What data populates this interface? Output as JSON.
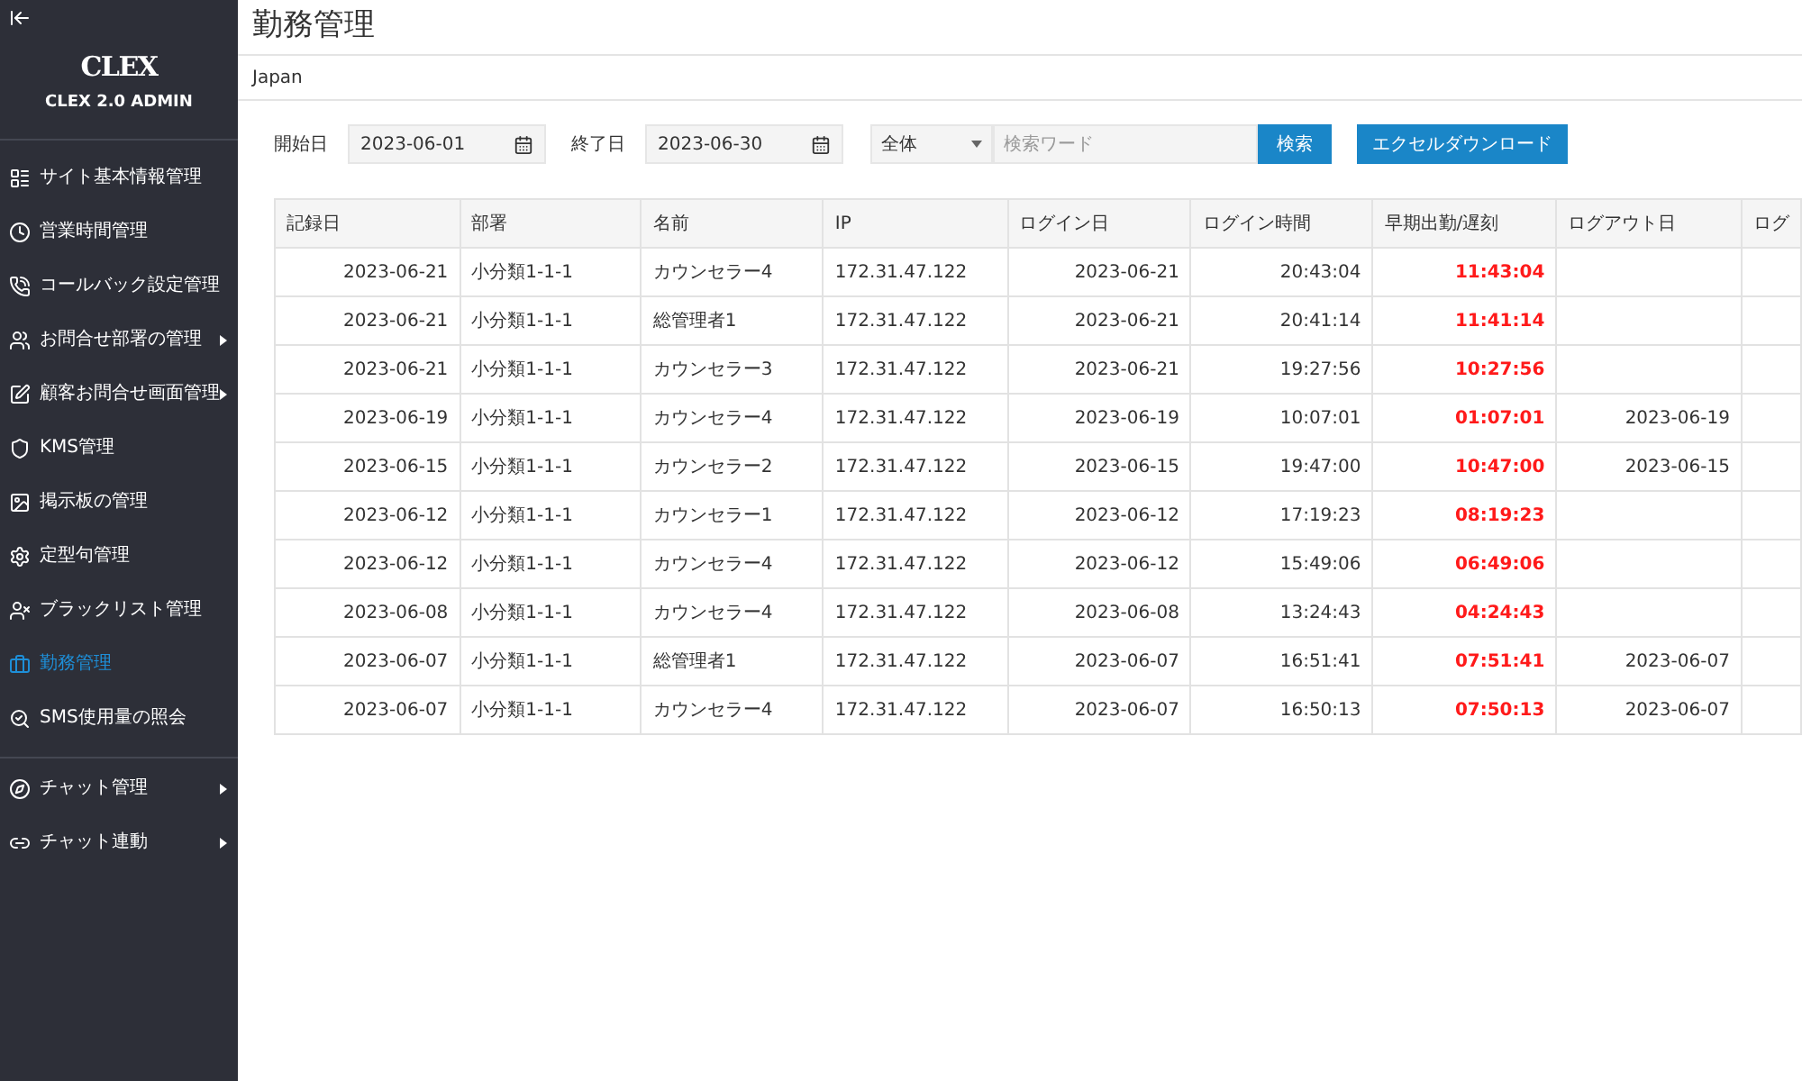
{
  "sidebar": {
    "brand": "CLEX",
    "subtitle": "CLEX 2.0 ADMIN",
    "items": [
      {
        "kind": "site",
        "label": "サイト基本情報管理",
        "selected": false,
        "submenu": false
      },
      {
        "kind": "clock",
        "label": "営業時間管理",
        "selected": false,
        "submenu": false
      },
      {
        "kind": "phone",
        "label": "コールバック設定管理",
        "selected": false,
        "submenu": false
      },
      {
        "kind": "users",
        "label": "お問合せ部署の管理",
        "selected": false,
        "submenu": true
      },
      {
        "kind": "edit",
        "label": "顧客お問合せ画面管理",
        "selected": false,
        "submenu": true
      },
      {
        "kind": "shield",
        "label": "KMS管理",
        "selected": false,
        "submenu": false
      },
      {
        "kind": "board",
        "label": "掲示板の管理",
        "selected": false,
        "submenu": false
      },
      {
        "kind": "gear",
        "label": "定型句管理",
        "selected": false,
        "submenu": false
      },
      {
        "kind": "userx",
        "label": "ブラックリスト管理",
        "selected": false,
        "submenu": false
      },
      {
        "kind": "briefcase",
        "label": "勤務管理",
        "selected": true,
        "submenu": false
      },
      {
        "kind": "search",
        "label": "SMS使用量の照会",
        "selected": false,
        "submenu": false
      },
      {
        "kind": "compass",
        "label": "チャット管理",
        "selected": false,
        "submenu": true
      },
      {
        "kind": "link",
        "label": "チャット連動",
        "selected": false,
        "submenu": true
      }
    ]
  },
  "page": {
    "title": "勤務管理",
    "breadcrumb": "Japan"
  },
  "filters": {
    "start_label": "開始日",
    "start_value": "2023-06-01",
    "end_label": "終了日",
    "end_value": "2023-06-30",
    "scope": "全体",
    "search_placeholder": "検索ワード",
    "search_button": "検索",
    "excel_button": "エクセルダウンロード"
  },
  "table": {
    "columns": [
      "記録日",
      "部署",
      "名前",
      "IP",
      "ログイン日",
      "ログイン時間",
      "早期出勤/遅刻",
      "ログアウト日",
      "ログ"
    ],
    "rows": [
      [
        "2023-06-21",
        "小分類1-1-1",
        "カウンセラー4",
        "172.31.47.122",
        "2023-06-21",
        "20:43:04",
        "11:43:04",
        "",
        ""
      ],
      [
        "2023-06-21",
        "小分類1-1-1",
        "総管理者1",
        "172.31.47.122",
        "2023-06-21",
        "20:41:14",
        "11:41:14",
        "",
        ""
      ],
      [
        "2023-06-21",
        "小分類1-1-1",
        "カウンセラー3",
        "172.31.47.122",
        "2023-06-21",
        "19:27:56",
        "10:27:56",
        "",
        ""
      ],
      [
        "2023-06-19",
        "小分類1-1-1",
        "カウンセラー4",
        "172.31.47.122",
        "2023-06-19",
        "10:07:01",
        "01:07:01",
        "2023-06-19",
        ""
      ],
      [
        "2023-06-15",
        "小分類1-1-1",
        "カウンセラー2",
        "172.31.47.122",
        "2023-06-15",
        "19:47:00",
        "10:47:00",
        "2023-06-15",
        ""
      ],
      [
        "2023-06-12",
        "小分類1-1-1",
        "カウンセラー1",
        "172.31.47.122",
        "2023-06-12",
        "17:19:23",
        "08:19:23",
        "",
        ""
      ],
      [
        "2023-06-12",
        "小分類1-1-1",
        "カウンセラー4",
        "172.31.47.122",
        "2023-06-12",
        "15:49:06",
        "06:49:06",
        "",
        ""
      ],
      [
        "2023-06-08",
        "小分類1-1-1",
        "カウンセラー4",
        "172.31.47.122",
        "2023-06-08",
        "13:24:43",
        "04:24:43",
        "",
        ""
      ],
      [
        "2023-06-07",
        "小分類1-1-1",
        "総管理者1",
        "172.31.47.122",
        "2023-06-07",
        "16:51:41",
        "07:51:41",
        "2023-06-07",
        ""
      ],
      [
        "2023-06-07",
        "小分類1-1-1",
        "カウンセラー4",
        "172.31.47.122",
        "2023-06-07",
        "16:50:13",
        "07:50:13",
        "2023-06-07",
        ""
      ]
    ]
  }
}
